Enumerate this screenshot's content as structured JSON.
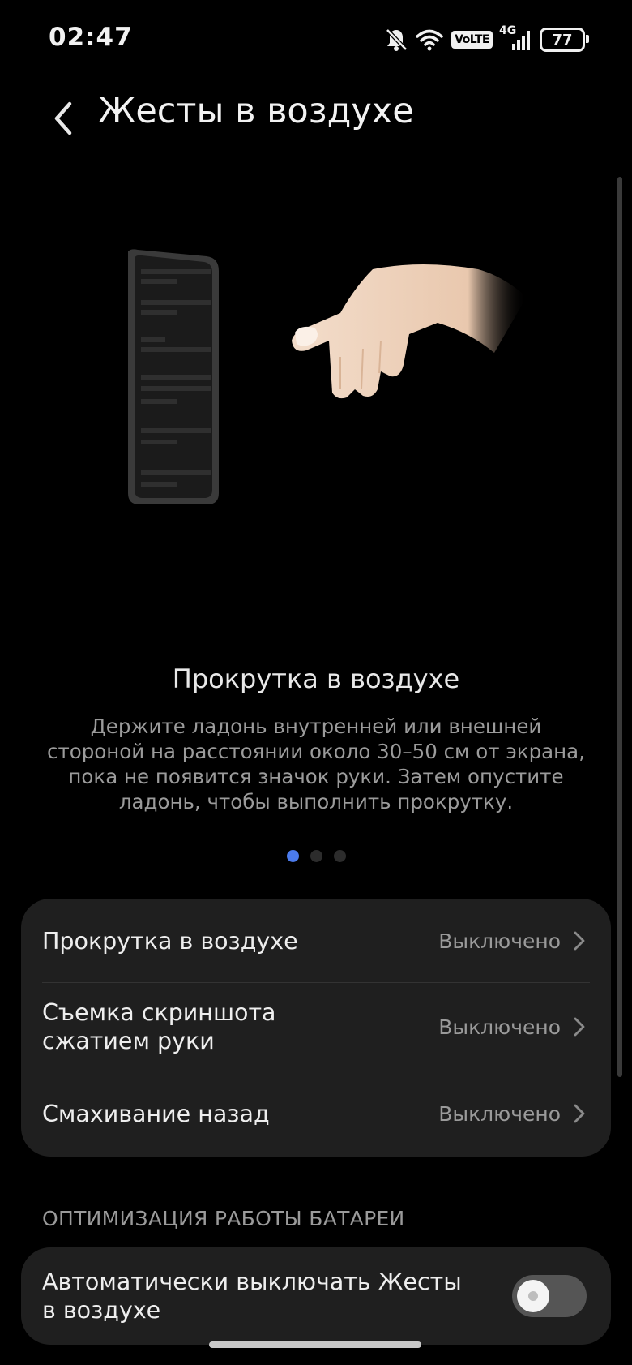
{
  "status_bar": {
    "time": "02:47",
    "volte": "VoLTE",
    "network": "4G",
    "battery": "77"
  },
  "header": {
    "title": "Жесты в воздухе"
  },
  "feature": {
    "title": "Прокрутка в воздухе",
    "description": "Держите ладонь внутренней или внешней стороной на расстоянии около 30–50 см от экрана, пока не появится значок руки. Затем опустите ладонь, чтобы выполнить прокрутку.",
    "pages_total": 3,
    "active_page": 1
  },
  "settings": [
    {
      "label": "Прокрутка в воздухе",
      "value": "Выключено"
    },
    {
      "label": "Съемка скриншота сжатием руки",
      "value": "Выключено"
    },
    {
      "label": "Смахивание назад",
      "value": "Выключено"
    }
  ],
  "battery_section": {
    "header": "ОПТИМИЗАЦИЯ РАБОТЫ БАТАРЕИ",
    "toggle_label": "Автоматически выключать Жесты в воздухе",
    "toggle_on": false
  },
  "colors": {
    "accent": "#4b7bec",
    "card_bg": "#1f1f1f",
    "background": "#000000"
  }
}
